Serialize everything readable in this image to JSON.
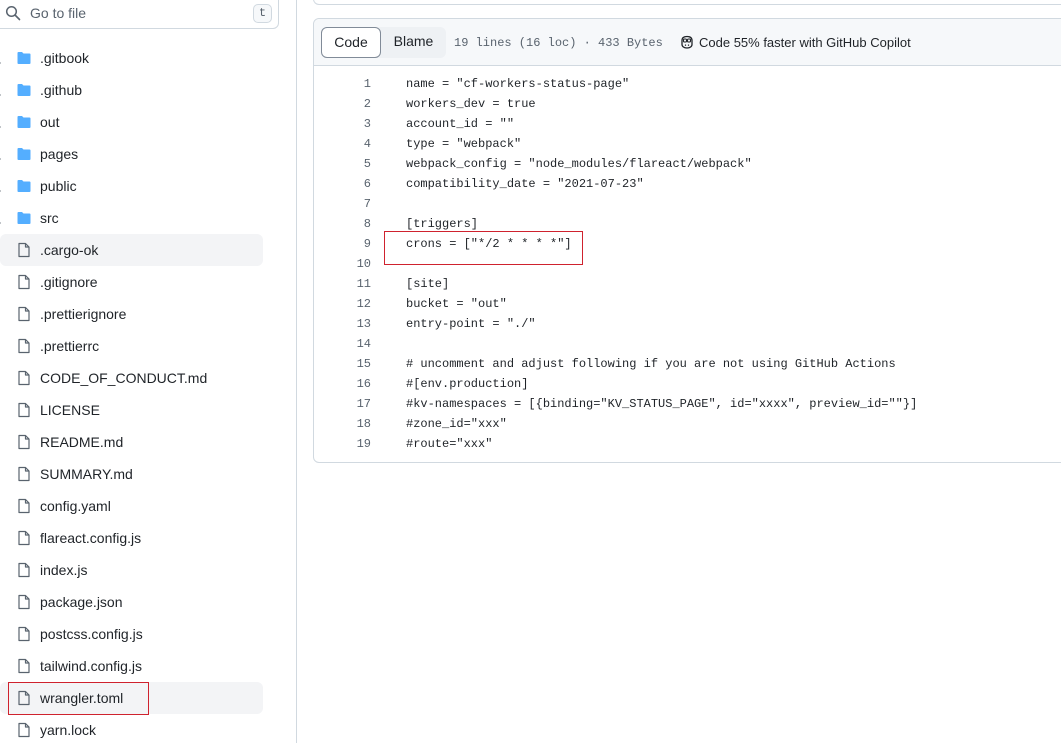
{
  "search": {
    "placeholder": "Go to file",
    "shortcut": "t"
  },
  "tree": [
    {
      "name": ".gitbook",
      "kind": "folder"
    },
    {
      "name": ".github",
      "kind": "folder"
    },
    {
      "name": "out",
      "kind": "folder"
    },
    {
      "name": "pages",
      "kind": "folder"
    },
    {
      "name": "public",
      "kind": "folder"
    },
    {
      "name": "src",
      "kind": "folder"
    },
    {
      "name": ".cargo-ok",
      "kind": "file",
      "selected": true
    },
    {
      "name": ".gitignore",
      "kind": "file"
    },
    {
      "name": ".prettierignore",
      "kind": "file"
    },
    {
      "name": ".prettierrc",
      "kind": "file"
    },
    {
      "name": "CODE_OF_CONDUCT.md",
      "kind": "file"
    },
    {
      "name": "LICENSE",
      "kind": "file"
    },
    {
      "name": "README.md",
      "kind": "file"
    },
    {
      "name": "SUMMARY.md",
      "kind": "file"
    },
    {
      "name": "config.yaml",
      "kind": "file"
    },
    {
      "name": "flareact.config.js",
      "kind": "file"
    },
    {
      "name": "index.js",
      "kind": "file"
    },
    {
      "name": "package.json",
      "kind": "file"
    },
    {
      "name": "postcss.config.js",
      "kind": "file"
    },
    {
      "name": "tailwind.config.js",
      "kind": "file"
    },
    {
      "name": "wrangler.toml",
      "kind": "file",
      "selected": true,
      "highlighted": true
    },
    {
      "name": "yarn.lock",
      "kind": "file"
    }
  ],
  "file_header": {
    "code_tab": "Code",
    "blame_tab": "Blame",
    "meta": "19 lines (16 loc) · 433 Bytes",
    "copilot": "Code 55% faster with GitHub Copilot"
  },
  "code_lines": [
    {
      "n": "1",
      "text": "name = \"cf-workers-status-page\""
    },
    {
      "n": "2",
      "text": "workers_dev = true"
    },
    {
      "n": "3",
      "text": "account_id = \"\""
    },
    {
      "n": "4",
      "text": "type = \"webpack\""
    },
    {
      "n": "5",
      "text": "webpack_config = \"node_modules/flareact/webpack\""
    },
    {
      "n": "6",
      "text": "compatibility_date = \"2021-07-23\""
    },
    {
      "n": "7",
      "text": ""
    },
    {
      "n": "8",
      "text": "[triggers]"
    },
    {
      "n": "9",
      "text": "crons = [\"*/2 * * * *\"]",
      "highlighted": true
    },
    {
      "n": "10",
      "text": ""
    },
    {
      "n": "11",
      "text": "[site]"
    },
    {
      "n": "12",
      "text": "bucket = \"out\""
    },
    {
      "n": "13",
      "text": "entry-point = \"./\""
    },
    {
      "n": "14",
      "text": ""
    },
    {
      "n": "15",
      "text": "# uncomment and adjust following if you are not using GitHub Actions"
    },
    {
      "n": "16",
      "text": "#[env.production]"
    },
    {
      "n": "17",
      "text": "#kv-namespaces = [{binding=\"KV_STATUS_PAGE\", id=\"xxxx\", preview_id=\"\"}]"
    },
    {
      "n": "18",
      "text": "#zone_id=\"xxx\""
    },
    {
      "n": "19",
      "text": "#route=\"xxx\""
    }
  ],
  "colors": {
    "folder": "#54aeff",
    "file": "#59636e",
    "annotation": "#cf222e",
    "syntax_keyword": "#0550ae",
    "syntax_section": "#6639ba"
  },
  "icons": {
    "search": "search-icon",
    "folder": "folder-icon",
    "file": "file-icon",
    "chevron": "chevron-right-icon",
    "copilot": "copilot-icon"
  }
}
